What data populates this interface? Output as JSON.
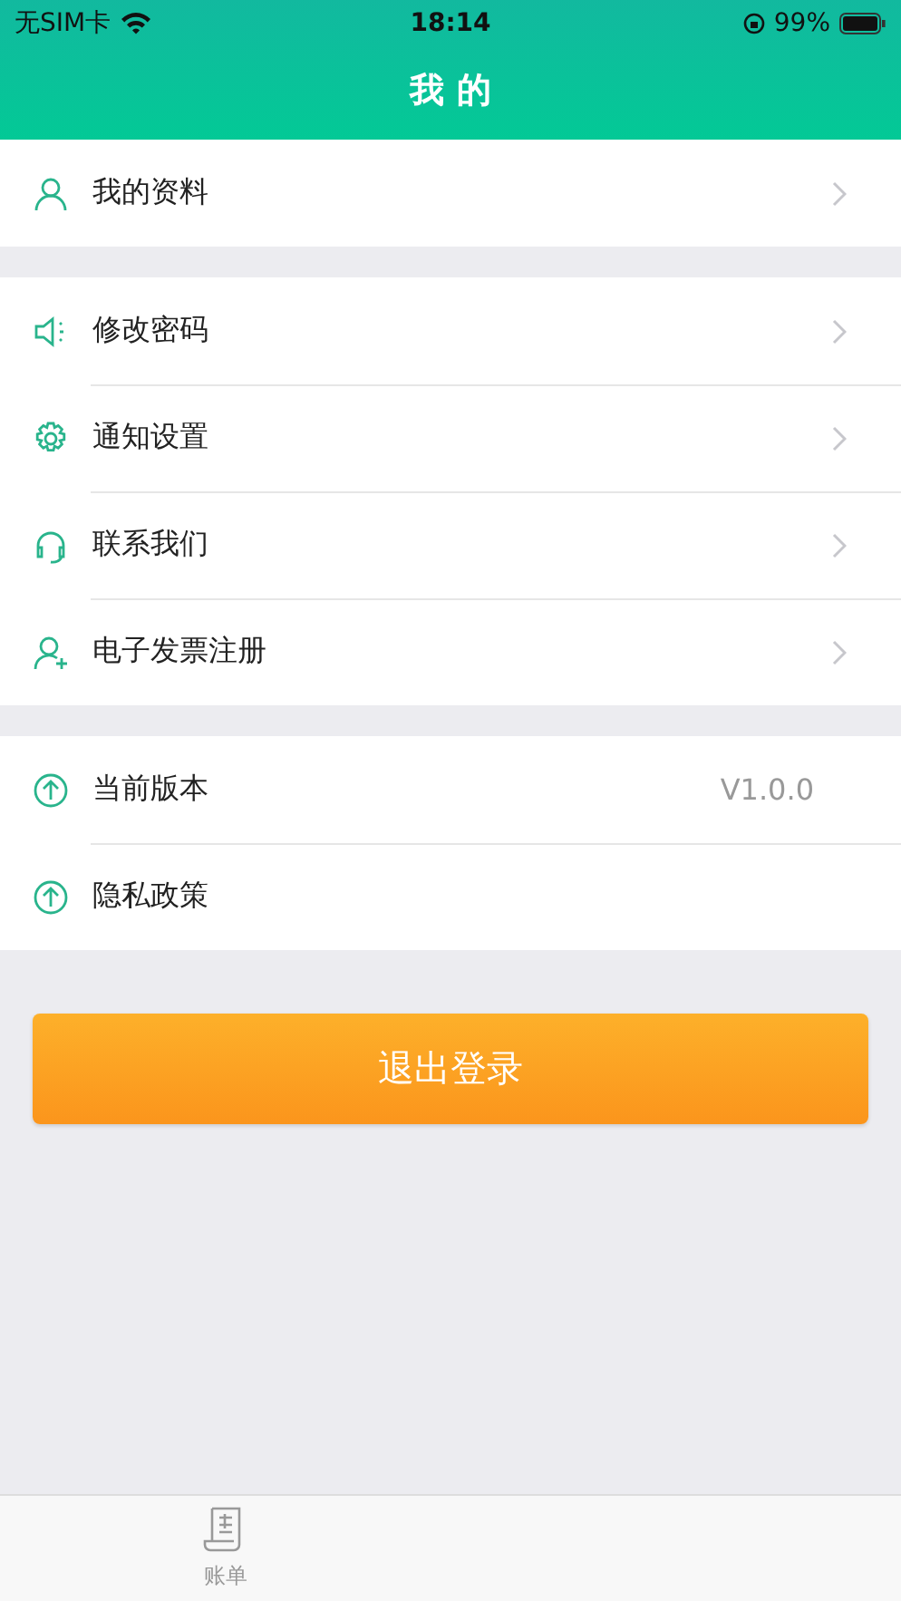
{
  "status_bar": {
    "carrier": "无SIM卡",
    "time": "18:14",
    "battery": "99%"
  },
  "header": {
    "title": "我 的"
  },
  "groups": [
    {
      "items": [
        {
          "kind": "person",
          "label": "我的资料"
        }
      ]
    },
    {
      "items": [
        {
          "kind": "speaker",
          "label": "修改密码"
        },
        {
          "kind": "gear",
          "label": "通知设置"
        },
        {
          "kind": "headset",
          "label": "联系我们"
        },
        {
          "kind": "personadd",
          "label": "电子发票注册"
        }
      ]
    },
    {
      "items": [
        {
          "kind": "up",
          "label": "当前版本",
          "value": "V1.0.0"
        },
        {
          "kind": "up",
          "label": "隐私政策"
        }
      ]
    }
  ],
  "logout_button": "退出登录",
  "tab_bar": [
    {
      "label": "账单",
      "selected": false
    }
  ]
}
